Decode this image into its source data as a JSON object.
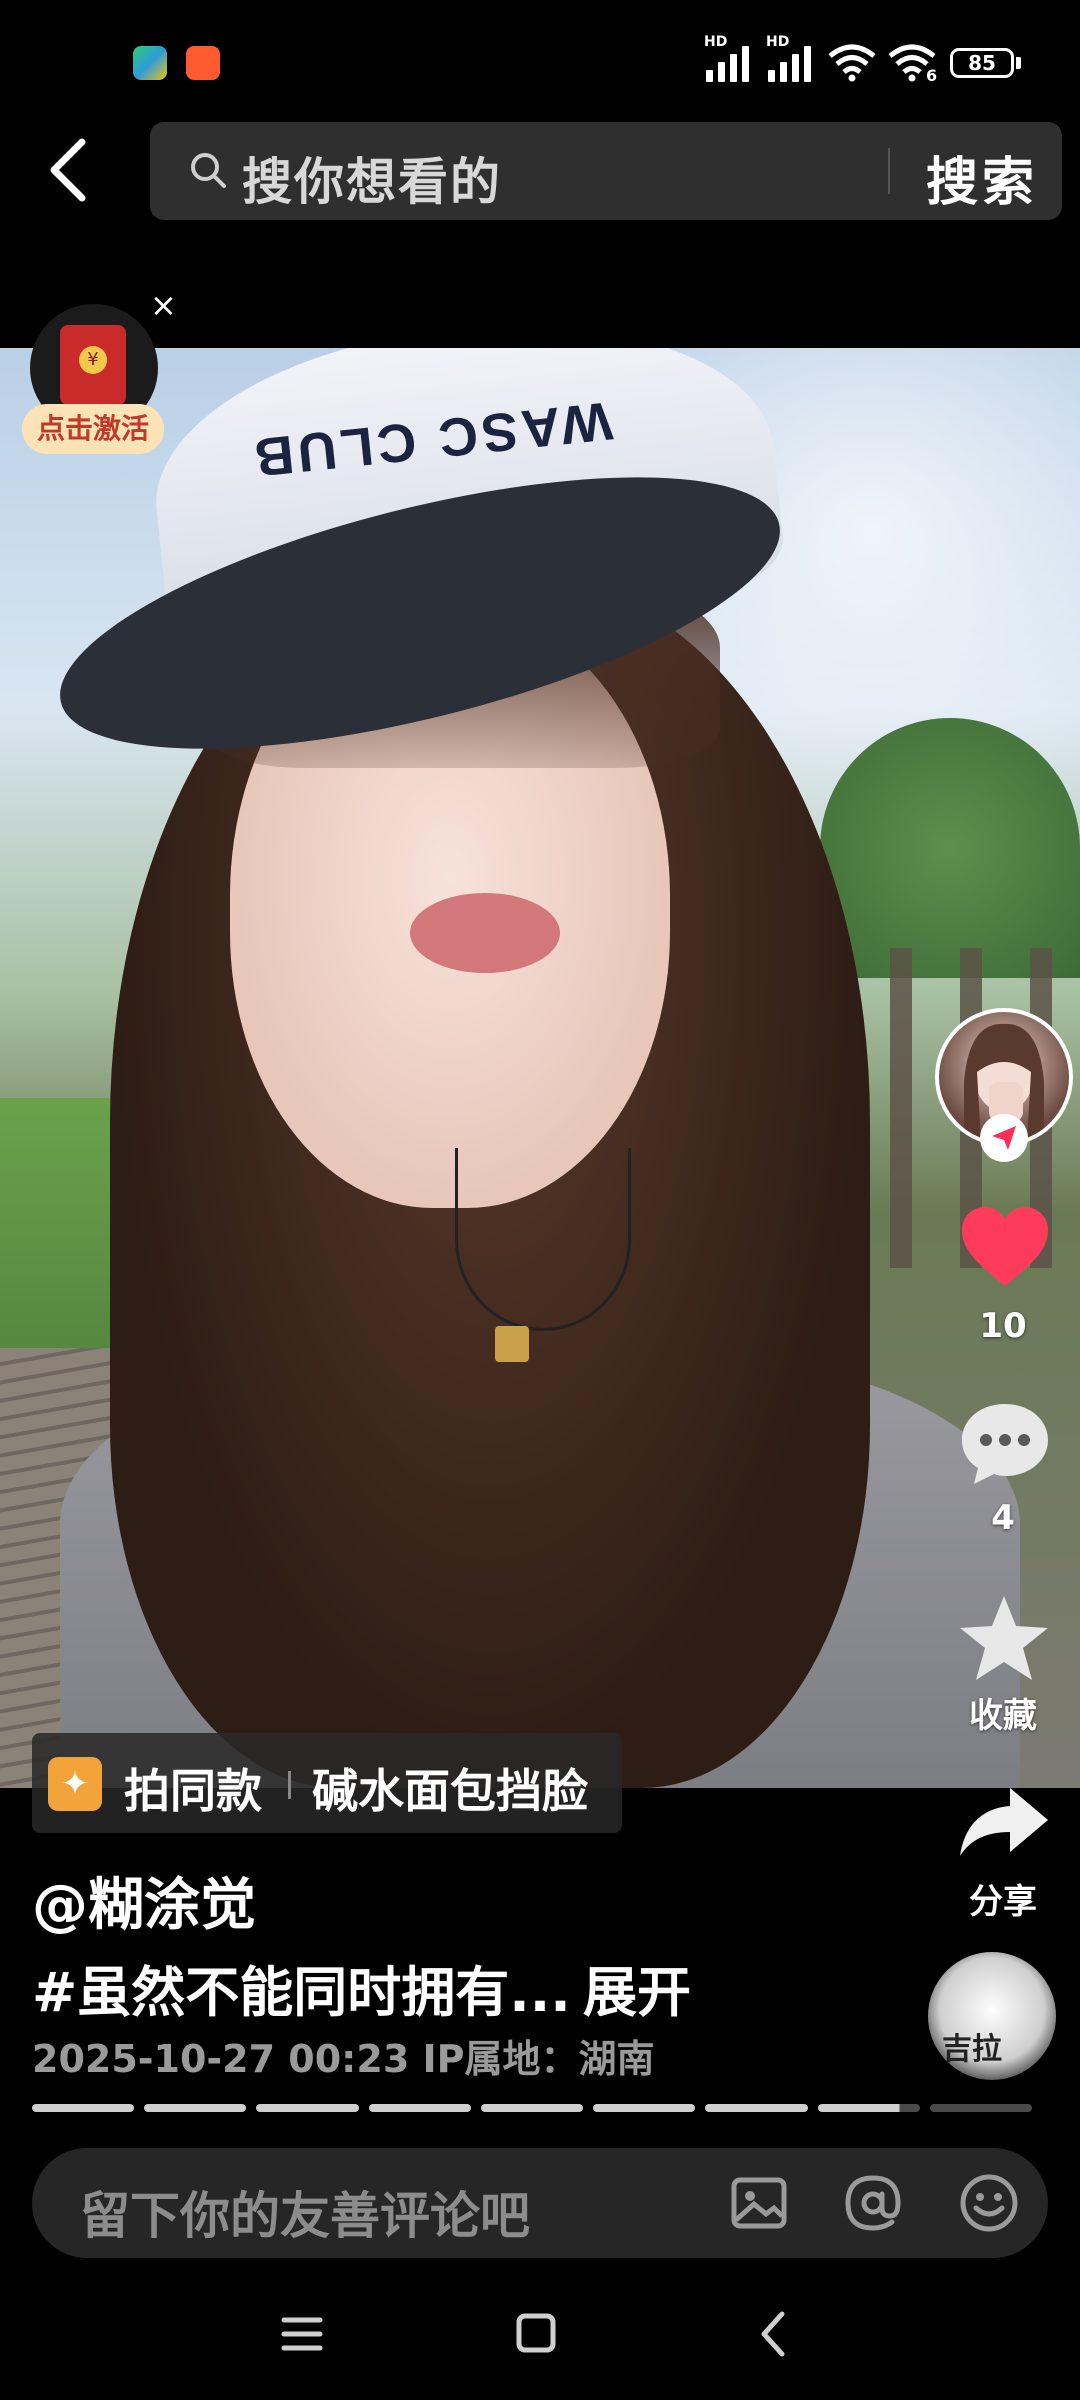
{
  "status_bar": {
    "hd_label_1": "HD",
    "hd_label_2": "HD",
    "wifi_number": "6",
    "battery": "85"
  },
  "header": {
    "search_placeholder": "搜你想看的",
    "search_button": "搜索"
  },
  "red_packet": {
    "close": "×",
    "label": "点击激活"
  },
  "photo": {
    "cap_text": "WASC CLUB"
  },
  "actions": {
    "like_count": "10",
    "comment_count": "4",
    "favorite_label": "收藏",
    "share_label": "分享",
    "like_color": "#ff3b5c"
  },
  "template_chip": {
    "label": "拍同款",
    "title": "碱水面包挡脸"
  },
  "post": {
    "author": "@糊涂觉",
    "hashtag": "#虽然不能同时拥有...",
    "expand": "展开",
    "meta": "2025-10-27 00:23  IP属地：湖南"
  },
  "music": {
    "disc_text": "吉拉"
  },
  "progress": {
    "segments": 9,
    "current": 8
  },
  "comment_bar": {
    "placeholder": "留下你的友善评论吧"
  }
}
